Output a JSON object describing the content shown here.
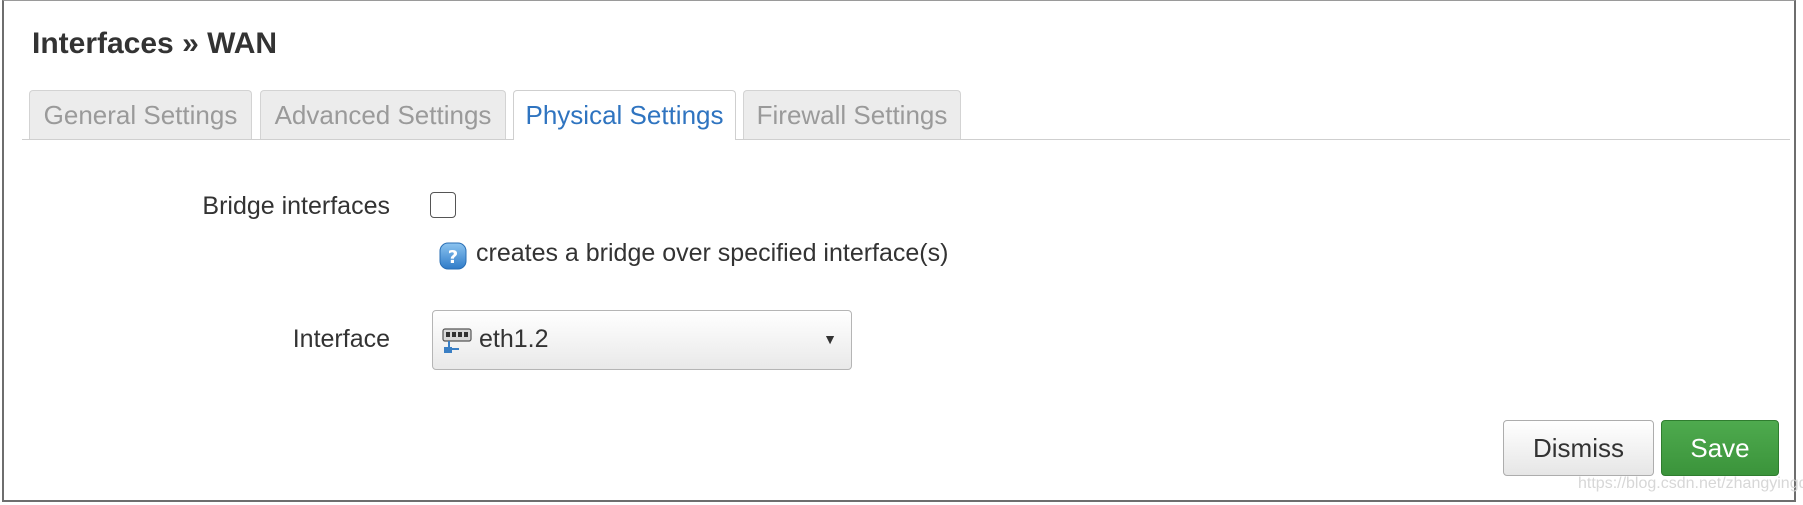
{
  "dialog": {
    "title": "Interfaces » WAN"
  },
  "tabs": [
    {
      "label": "General Settings",
      "active": false
    },
    {
      "label": "Advanced Settings",
      "active": false
    },
    {
      "label": "Physical Settings",
      "active": true
    },
    {
      "label": "Firewall Settings",
      "active": false
    }
  ],
  "form": {
    "bridge": {
      "label": "Bridge interfaces",
      "checked": false,
      "help_icon": "question-help-icon",
      "help_text": "creates a bridge over specified interface(s)"
    },
    "interface": {
      "label": "Interface",
      "device_icon": "ethernet-switch-icon",
      "value": "eth1.2",
      "caret_icon": "dropdown-caret-icon"
    }
  },
  "buttons": {
    "dismiss": "Dismiss",
    "save": "Save"
  },
  "watermark": "https://blog.csdn.net/zhangyingda",
  "colors": {
    "active_tab_text": "#2f74c0",
    "inactive_tab_text": "#9a9a9a",
    "save_button": "#449d44",
    "help_icon": "#4a90d9"
  }
}
